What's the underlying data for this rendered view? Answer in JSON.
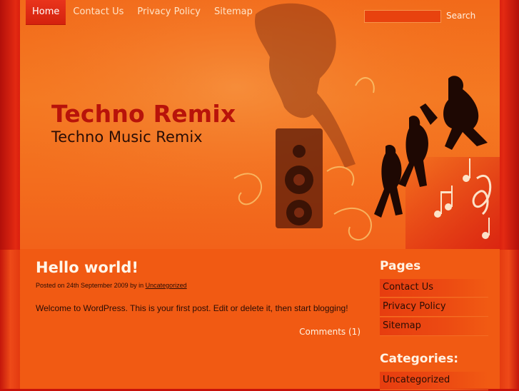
{
  "nav": {
    "items": [
      {
        "label": "Home",
        "active": true
      },
      {
        "label": "Contact Us",
        "active": false
      },
      {
        "label": "Privacy Policy",
        "active": false
      },
      {
        "label": "Sitemap",
        "active": false
      }
    ]
  },
  "search": {
    "value": "",
    "button_label": "Search"
  },
  "header": {
    "title": "Techno Remix",
    "tagline": "Techno Music Remix"
  },
  "post": {
    "title": "Hello world!",
    "meta_prefix": "Posted on 24th September 2009 by in",
    "category": "Uncategorized",
    "body": "Welcome to WordPress. This is your first post. Edit or delete it, then start blogging!",
    "comments": "Comments (1)"
  },
  "sidebar": {
    "pages_title": "Pages",
    "pages": [
      {
        "label": "Contact Us"
      },
      {
        "label": "Privacy Policy"
      },
      {
        "label": "Sitemap"
      }
    ],
    "categories_title": "Categories:",
    "categories": [
      {
        "label": "Uncategorized"
      }
    ]
  },
  "colors": {
    "accent": "#f15a13",
    "header_bg": "#f47a22",
    "outer_bg": "#c8120c",
    "title_red": "#b8130a"
  }
}
